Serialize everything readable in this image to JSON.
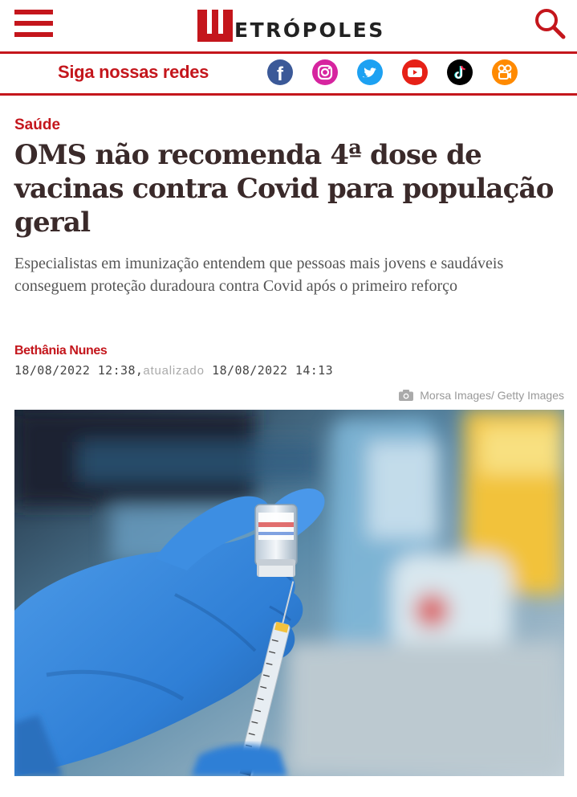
{
  "header": {
    "logo_text": "ETRÓPOLES",
    "logo_alt": "Metrópoles"
  },
  "social": {
    "label": "Siga nossas redes",
    "networks": [
      {
        "name": "facebook",
        "icon": "facebook-icon",
        "color": "#3b5998"
      },
      {
        "name": "instagram",
        "icon": "instagram-icon",
        "color": "#d6249f"
      },
      {
        "name": "twitter",
        "icon": "twitter-icon",
        "color": "#1da1f2"
      },
      {
        "name": "youtube",
        "icon": "youtube-icon",
        "color": "#e62117"
      },
      {
        "name": "tiktok",
        "icon": "tiktok-icon",
        "color": "#000000"
      },
      {
        "name": "kwai",
        "icon": "kwai-icon",
        "color": "#ff8a00"
      }
    ]
  },
  "article": {
    "category": "Saúde",
    "title": "OMS não recomenda 4ª dose de vacinas contra Covid para população geral",
    "subtitle": "Especialistas em imunização entendem que pessoas mais jovens e saudáveis conseguem proteção duradoura contra Covid após o primeiro reforço",
    "author": "Bethânia Nunes",
    "published": "18/08/2022 12:38,",
    "updated_label": "atualizado",
    "updated": " 18/08/2022 14:13",
    "photo_credit": "Morsa Images/ Getty Images"
  },
  "colors": {
    "brand": "#c4161c",
    "title": "#3a2a2a",
    "glove": "#2f7fd6"
  }
}
